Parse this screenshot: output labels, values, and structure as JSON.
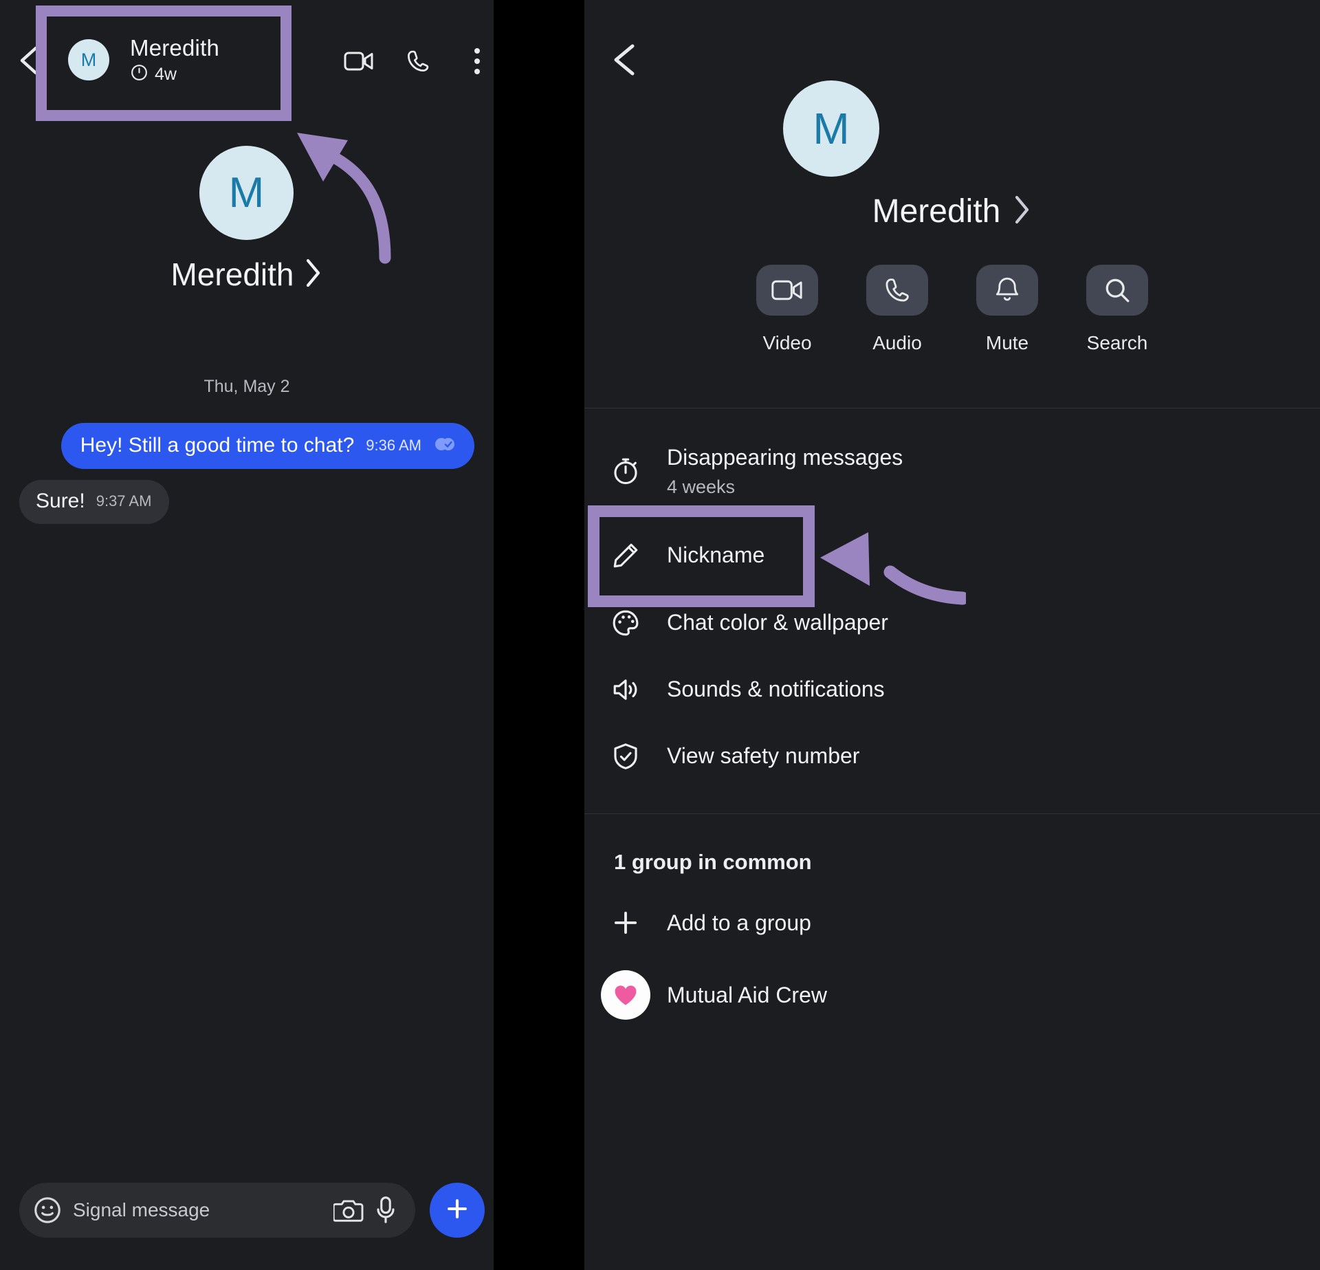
{
  "app": "Signal",
  "accent": {
    "annotation_purple": "#9b85c0",
    "bubble_blue": "#2c58f0",
    "avatar_bg": "#d6e8f0",
    "avatar_letter": "#1a7ba8",
    "chip_bg": "#434754",
    "panel_bg": "#1b1d21",
    "heart_pink": "#ef5ba1"
  },
  "left_screen": {
    "topbar": {
      "back_icon": "back-arrow-icon",
      "avatar_letter": "M",
      "contact_name": "Meredith",
      "disappearing_icon": "timer-icon",
      "disappearing_value": "4w",
      "video_icon": "video-call-icon",
      "audio_icon": "phone-call-icon",
      "overflow_icon": "more-vertical-icon"
    },
    "profile": {
      "avatar_letter": "M",
      "name": "Meredith",
      "chevron": "chevron-right-icon"
    },
    "date_divider": "Thu, May 2",
    "messages": [
      {
        "direction": "outgoing",
        "text": "Hey! Still a good time to chat?",
        "time": "9:36 AM",
        "status_icon": "delivered-check-icon"
      },
      {
        "direction": "incoming",
        "text": "Sure!",
        "time": "9:37 AM"
      }
    ],
    "composer": {
      "emoji_icon": "emoji-smiley-icon",
      "placeholder": "Signal message",
      "value": "",
      "camera_icon": "camera-icon",
      "mic_icon": "microphone-icon",
      "attach_icon": "plus-icon"
    }
  },
  "right_screen": {
    "back_icon": "back-arrow-icon",
    "profile": {
      "avatar_letter": "M",
      "name": "Meredith",
      "chevron": "chevron-right-icon"
    },
    "actions": [
      {
        "icon": "video-call-icon",
        "label": "Video"
      },
      {
        "icon": "phone-call-icon",
        "label": "Audio"
      },
      {
        "icon": "bell-icon",
        "label": "Mute"
      },
      {
        "icon": "search-icon",
        "label": "Search"
      }
    ],
    "settings": [
      {
        "icon": "timer-icon",
        "title": "Disappearing messages",
        "subtitle": "4 weeks"
      },
      {
        "icon": "pencil-icon",
        "title": "Nickname",
        "subtitle": ""
      },
      {
        "icon": "palette-icon",
        "title": "Chat color & wallpaper",
        "subtitle": ""
      },
      {
        "icon": "speaker-icon",
        "title": "Sounds & notifications",
        "subtitle": ""
      },
      {
        "icon": "shield-check-icon",
        "title": "View safety number",
        "subtitle": ""
      }
    ],
    "groups_section": {
      "title": "1 group in common",
      "add_to_group": {
        "icon": "plus-icon",
        "label": "Add to a group"
      },
      "groups": [
        {
          "icon": "heart-avatar-icon",
          "label": "Mutual Aid Crew"
        }
      ]
    }
  },
  "annotations": [
    {
      "name": "highlight-contact-header",
      "target": "contact header with name and disappearing timer"
    },
    {
      "name": "arrow-to-contact-header",
      "target": "points up-left to contact header"
    },
    {
      "name": "highlight-nickname-row",
      "target": "Nickname settings row"
    },
    {
      "name": "arrow-to-nickname-row",
      "target": "points left to Nickname row"
    }
  ]
}
